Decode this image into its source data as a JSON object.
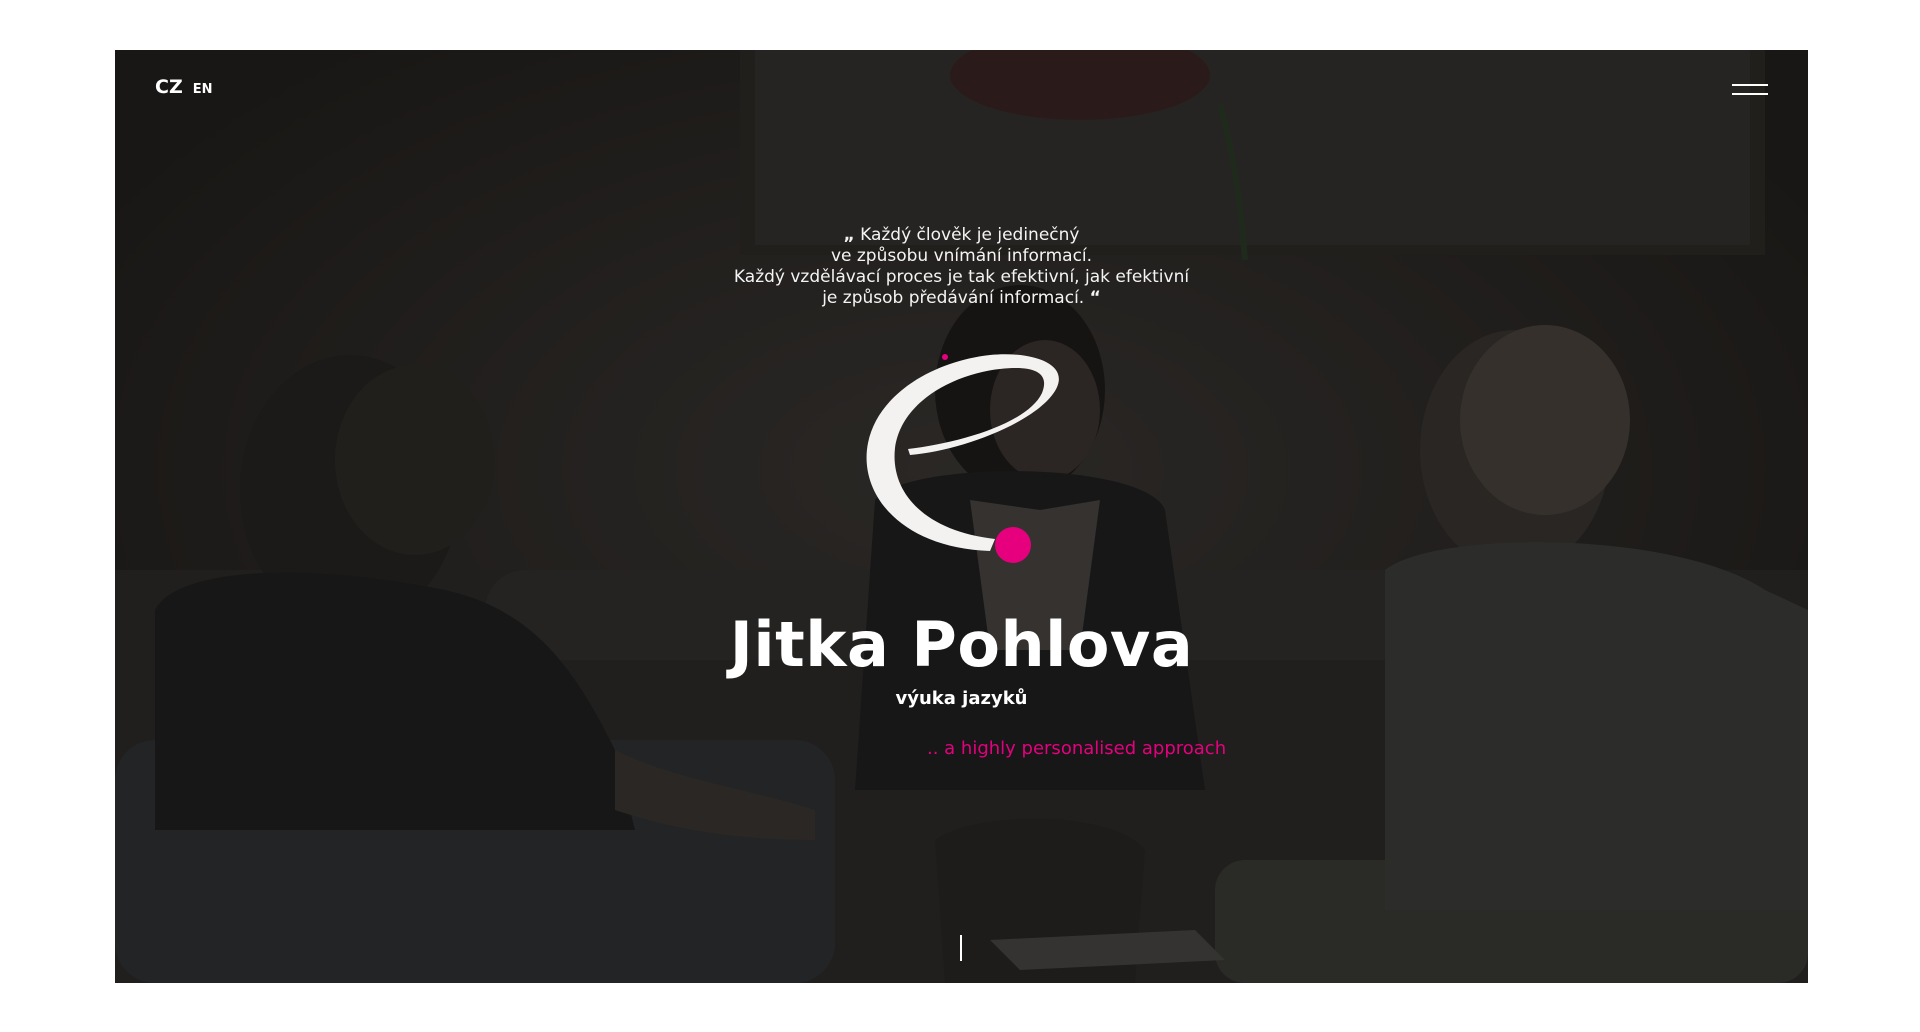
{
  "languages": {
    "active": "CZ",
    "other": "EN"
  },
  "menu": {
    "icon": "hamburger-menu-icon"
  },
  "quote": {
    "open_mark": "„",
    "lines": [
      "Každý člověk je jedinečný",
      "ve způsobu vnímání informací.",
      "Každý vzdělávací proces je tak efektivní, jak efektivní",
      "je způsob předávání informací."
    ],
    "close_mark": "“"
  },
  "hero": {
    "name": "Jitka Pohlova",
    "subtitle": "výuka jazyků",
    "tagline": ".. a highly personalised approach"
  },
  "colors": {
    "accent": "#e6007e",
    "overlay": "#242120",
    "text": "#ffffff"
  }
}
